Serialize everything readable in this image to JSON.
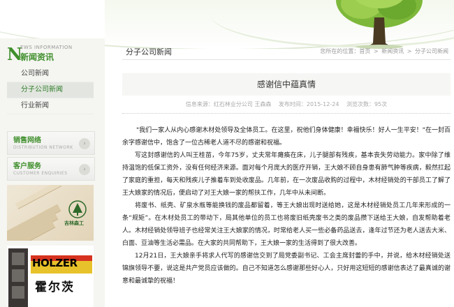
{
  "sidebar": {
    "section_letter": "N",
    "section_en": "EWS INFORMATION",
    "section_cn": "新闻资讯",
    "menu": [
      {
        "label": "公司新闻",
        "active": false
      },
      {
        "label": "分子公司新闻",
        "active": true
      },
      {
        "label": "行业新闻",
        "active": false
      }
    ],
    "promos": [
      {
        "title": "销售网络",
        "subtitle": "DISTRIBUTION NETWORK",
        "arrow": "›"
      },
      {
        "title": "客户服务",
        "subtitle": "CUSTOMER ENQUIRIES",
        "arrow": "›"
      }
    ],
    "ad1_brand": "吉林森工",
    "ad2_brand_en": "HOLZER",
    "ad2_brand_cn": "霍尔茨"
  },
  "main": {
    "category_title": "分子公司新闻",
    "breadcrumb": [
      "您所在的位置：首页",
      ">",
      "新闻资讯",
      ">",
      "分子公司新闻"
    ],
    "article_title": "感谢信中蕴真情",
    "meta": {
      "source": "信息来源：红石林业分公司 王森森",
      "date": "发布时间：2015-12-24",
      "views": "浏览次数：95次"
    },
    "paragraphs": [
      "\"我们一家人从内心感谢木材处领导及全体员工。在这里，祝他们身体健康！幸福快乐！好人一生平安！\"在一封百余字感谢信中，饱含了一位古稀老人道不尽的感谢和祝福。",
      "写这封感谢信的人叫王桂苗，今年75岁，丈夫常年瘫痪在床，儿子腿部有残疾，基本丧失劳动能力。家中除了维持温饱的低保工资外，没有任何经济来源。面对每个月庞大的医疗开销，王大娘不顾自身患有肺气肿等疾病，毅然扛起了家庭的重担，每天和残疾儿子推着车到处收废品。几年前，在一次废品收购的过程中，木材经销处的干部员工了解了王大娘家的情况后，便启动了对王大娘一家的帮扶工作，几年中从未间断。",
      "将废书、纸壳、矿泉水瓶等能换钱的废品都留着，等王大娘出现时送给她，这是木材经销处员工几年来形成的一条“规矩”。在木材处员工的带动下，局其他单位的员工也将废旧纸壳废书之类的废品攒下送给王大娘，自发帮助着老人。木材经销处领导班子也经常关注王大娘家的情况，时常给老人买一些必备药品送去，逢年过节还为老人送去大米、白面、豆油等生活必需品。在大家的共同帮助下，王大娘一家的生活得到了很大改善。",
      "12月21日，王大娘亲手将求人代写的感谢信交到了局党委副书记、工会主席封蕾的手中，并说，给木材经销处送锦旗领导不要，说这是共产党员应该做的。自己不知道怎么感谢那些好心人，只好用这短短的感谢信表达了最真诚的谢意和最诚挚的祝福！"
    ]
  },
  "colors": {
    "accent_green": "#3f8f2c",
    "sidebar_bg": "#f5f5f1",
    "title_bg": "#f6f6f4"
  }
}
